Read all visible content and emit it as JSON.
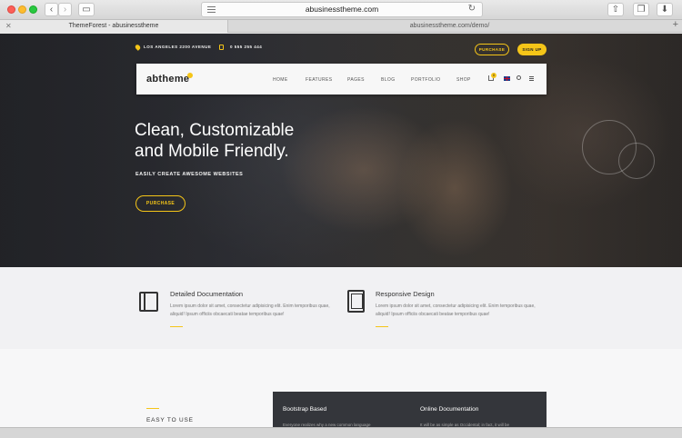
{
  "browser": {
    "url": "abusinesstheme.com",
    "tabs": [
      {
        "label": "ThemeForest - abusinesstheme"
      },
      {
        "label": "abusinesstheme.com/demo/"
      }
    ]
  },
  "topbar": {
    "address": "LOS ANGELES 2200 AVENUE",
    "phone": "0 555 255 444",
    "purchase_label": "PURCHASE",
    "signup_label": "SIGN UP"
  },
  "nav": {
    "logo": "abtheme",
    "links": [
      "HOME",
      "FEATURES",
      "PAGES",
      "BLOG",
      "PORTFOLIO",
      "SHOP"
    ],
    "cart_count": "0"
  },
  "hero": {
    "title": "Clean, Customizable\nand Mobile Friendly.",
    "subtitle": "EASILY CREATE AWESOME WEBSITES",
    "button_label": "PURCHASE"
  },
  "features": [
    {
      "title": "Detailed Documentation",
      "text": "Lorem ipsum dolor sit amet, consectetur adipisicing elit. Enim temporibus quae, aliquid! Ipsum officiis obcaecati beatae temporibus quae!",
      "icon": "book-icon"
    },
    {
      "title": "Responsive Design",
      "text": "Lorem ipsum dolor sit amet, consectetur adipisicing elit. Enim temporibus quae, aliquid! Ipsum officiis obcaecati beatae temporibus quae!",
      "icon": "mobile-icon"
    }
  ],
  "lower": {
    "easy_title": "EASY TO USE",
    "boxes": [
      {
        "title": "Bootstrap Based",
        "text": "Everyone realizes why a new common language"
      },
      {
        "title": "Online Documentation",
        "text": "It will be as simple as Occidental; in fact, it will be"
      }
    ]
  },
  "colors": {
    "accent": "#f5c518",
    "dark": "#34363b"
  }
}
